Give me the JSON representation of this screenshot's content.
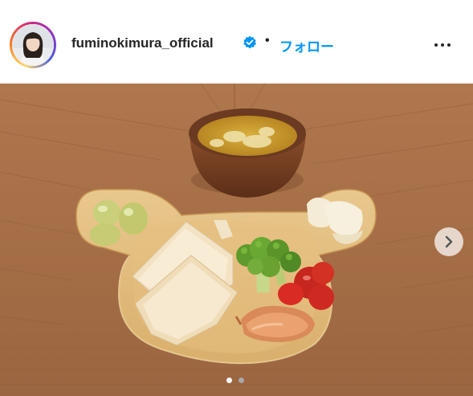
{
  "header": {
    "username": "fuminokimura_official",
    "verified": true,
    "separator": "•",
    "follow_label": "フォロー",
    "more_icon": "more-options-icon"
  },
  "carousel": {
    "slide_count": 2,
    "current_slide": 1,
    "next_icon": "chevron-right-icon",
    "active_dot_color": "#ffffff",
    "inactive_dot_color": "#a8a8a8"
  },
  "colors": {
    "follow": "#0095f6",
    "text": "#262626",
    "verified": "#0095f6"
  }
}
